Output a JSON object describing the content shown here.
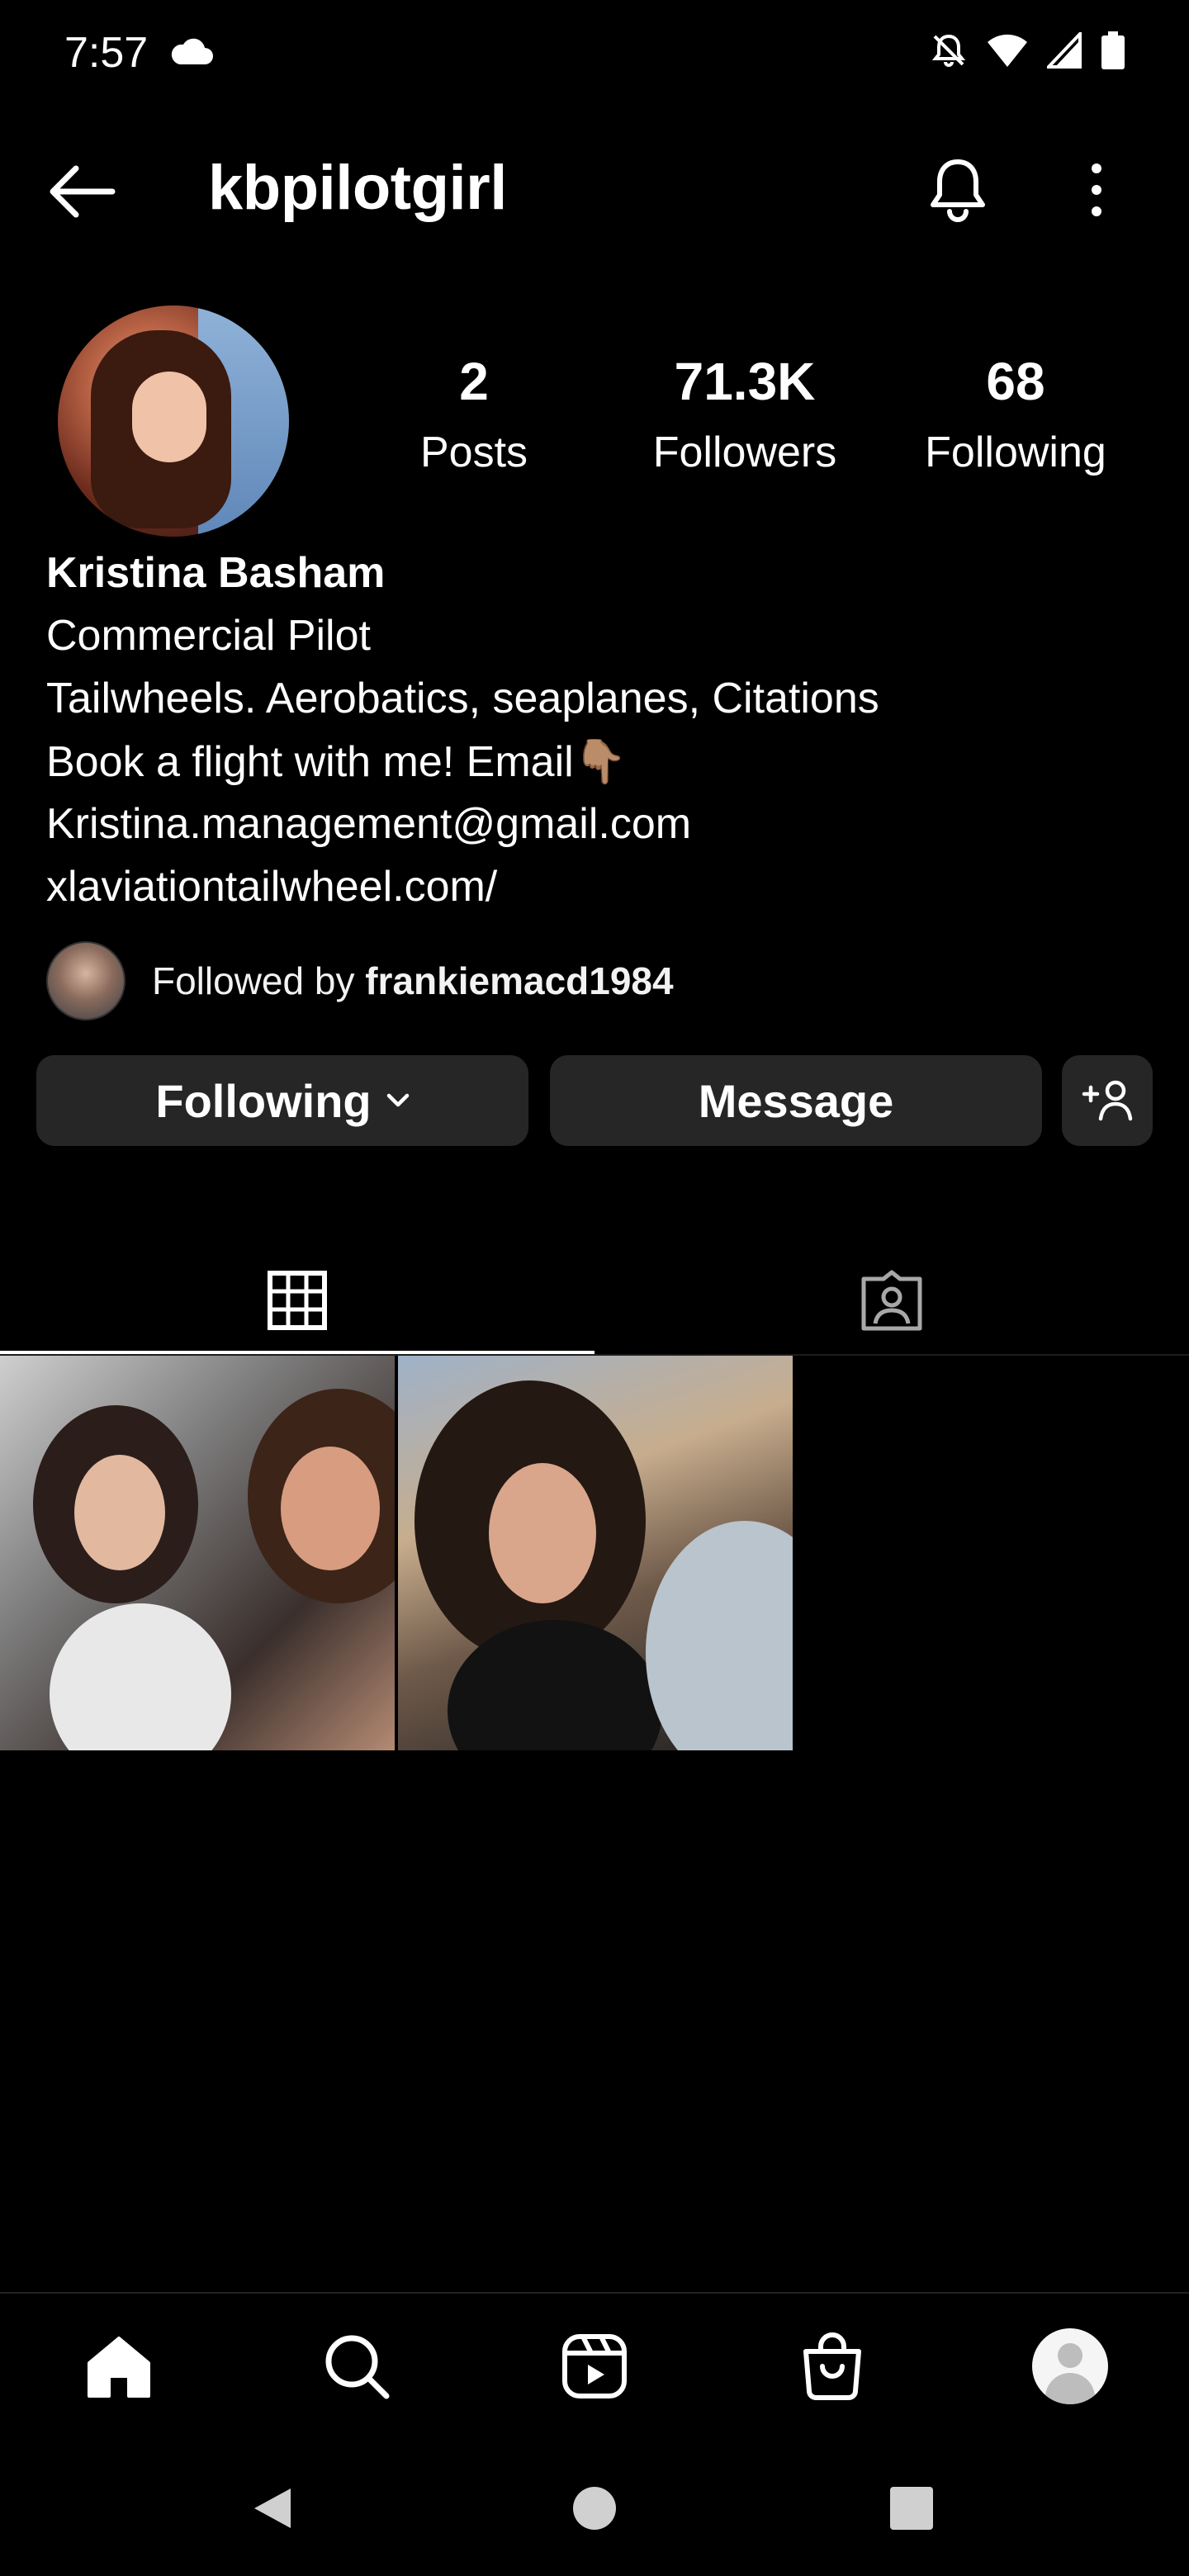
{
  "status_bar": {
    "time": "7:57",
    "icons": [
      "cloud-icon",
      "notifications-off-icon",
      "wifi-icon",
      "cell-signal-icon",
      "battery-icon"
    ]
  },
  "header": {
    "title": "kbpilotgirl"
  },
  "profile": {
    "stats": [
      {
        "value": "2",
        "label": "Posts"
      },
      {
        "value": "71.3K",
        "label": "Followers"
      },
      {
        "value": "68",
        "label": "Following"
      }
    ],
    "name": "Kristina Basham",
    "bio": [
      "Commercial Pilot",
      "Tailwheels. Aerobatics, seaplanes, Citations",
      "Book a flight with me! Email👇🏽",
      "Kristina.management@gmail.com",
      "xlaviationtailwheel.com/"
    ],
    "followed_by_prefix": "Followed by ",
    "followed_by_user": "frankiemacd1984"
  },
  "actions": {
    "following_label": "Following",
    "message_label": "Message"
  },
  "tabs": [
    "posts-grid",
    "tagged"
  ],
  "bottom_nav": [
    "home",
    "search",
    "reels",
    "shop",
    "profile"
  ],
  "system_nav": [
    "back",
    "home",
    "recents"
  ]
}
